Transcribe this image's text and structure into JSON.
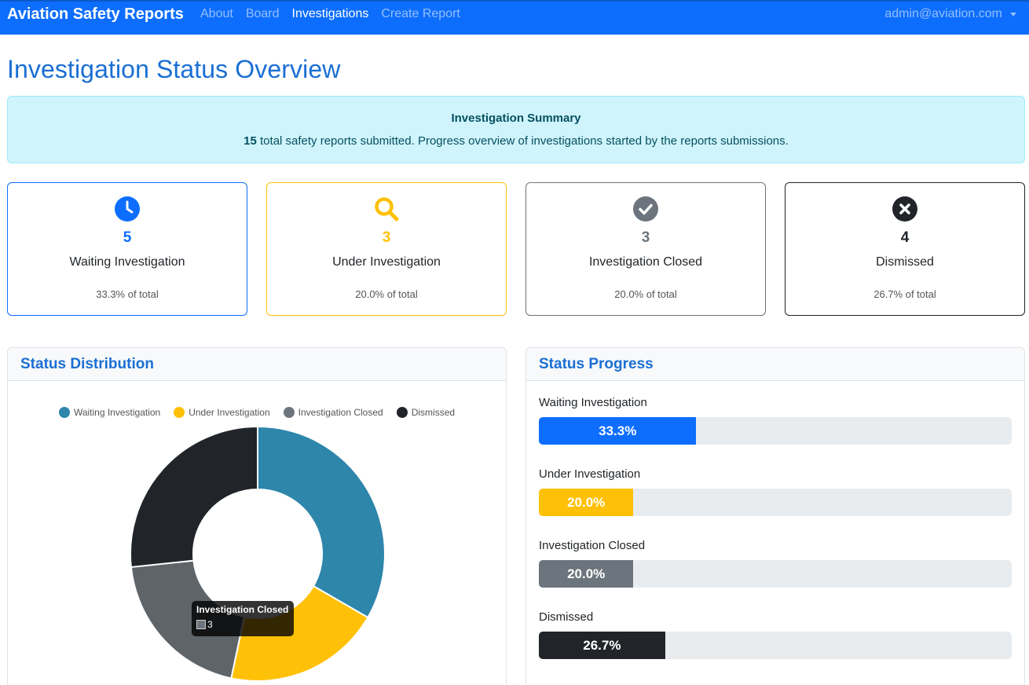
{
  "navbar": {
    "brand": "Aviation Safety Reports",
    "links": [
      {
        "label": "About",
        "active": false
      },
      {
        "label": "Board",
        "active": false
      },
      {
        "label": "Investigations",
        "active": true
      },
      {
        "label": "Create Report",
        "active": false
      }
    ],
    "user": "admin@aviation.com"
  },
  "page": {
    "title": "Investigation Status Overview"
  },
  "summary": {
    "title": "Investigation Summary",
    "total": "15",
    "text": "total safety reports submitted. Progress overview of investigations started by the reports submissions."
  },
  "stats": [
    {
      "count": "5",
      "label": "Waiting Investigation",
      "pct": "33.3% of total",
      "color": "#0d6efd",
      "icon": "clock-icon"
    },
    {
      "count": "3",
      "label": "Under Investigation",
      "pct": "20.0% of total",
      "color": "#ffc107",
      "icon": "search-icon"
    },
    {
      "count": "3",
      "label": "Investigation Closed",
      "pct": "20.0% of total",
      "color": "#6c757d",
      "icon": "check-circle-icon"
    },
    {
      "count": "4",
      "label": "Dismissed",
      "pct": "26.7% of total",
      "color": "#212529",
      "icon": "x-circle-icon"
    }
  ],
  "distribution": {
    "header": "Status Distribution",
    "tooltip": {
      "title": "Investigation Closed",
      "value": "3"
    }
  },
  "progress": {
    "header": "Status Progress",
    "items": [
      {
        "label": "Waiting Investigation",
        "value": 33.3,
        "text": "33.3%",
        "color": "#0d6efd"
      },
      {
        "label": "Under Investigation",
        "value": 20.0,
        "text": "20.0%",
        "color": "#ffc107"
      },
      {
        "label": "Investigation Closed",
        "value": 20.0,
        "text": "20.0%",
        "color": "#6c757d"
      },
      {
        "label": "Dismissed",
        "value": 26.7,
        "text": "26.7%",
        "color": "#212529"
      }
    ]
  },
  "chart_data": {
    "type": "pie",
    "categories": [
      "Waiting Investigation",
      "Under Investigation",
      "Investigation Closed",
      "Dismissed"
    ],
    "values": [
      5,
      3,
      3,
      4
    ],
    "colors": [
      "#2e86ab",
      "#ffc107",
      "#5f6469",
      "#212529"
    ],
    "legend": "top"
  }
}
